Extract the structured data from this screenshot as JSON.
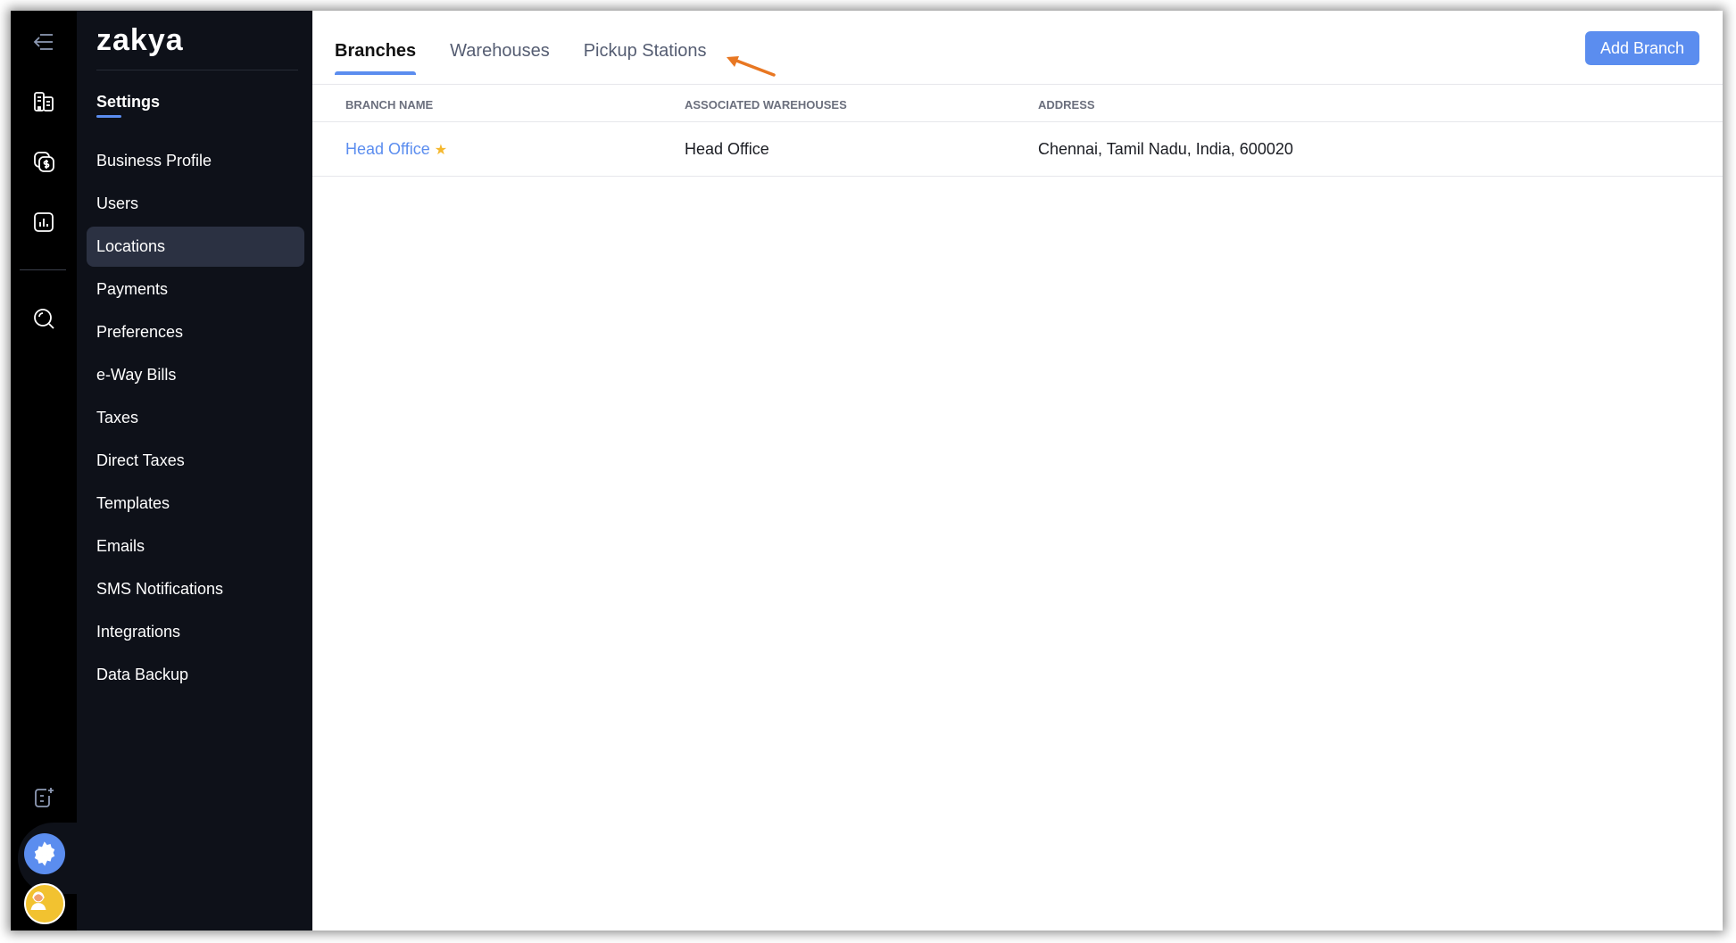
{
  "rail": {
    "icons": [
      "back-menu-icon",
      "branches-icon",
      "sales-icon",
      "reports-icon",
      "search-icon",
      "new-entry-icon",
      "settings-gear-icon",
      "user-avatar"
    ]
  },
  "sidebar": {
    "logo": "zakya",
    "title": "Settings",
    "items": [
      {
        "label": "Business Profile"
      },
      {
        "label": "Users"
      },
      {
        "label": "Locations",
        "active": true
      },
      {
        "label": "Payments"
      },
      {
        "label": "Preferences"
      },
      {
        "label": "e-Way Bills"
      },
      {
        "label": "Taxes"
      },
      {
        "label": "Direct Taxes"
      },
      {
        "label": "Templates"
      },
      {
        "label": "Emails"
      },
      {
        "label": "SMS Notifications"
      },
      {
        "label": "Integrations"
      },
      {
        "label": "Data Backup"
      }
    ]
  },
  "main": {
    "tabs": [
      {
        "label": "Branches",
        "active": true
      },
      {
        "label": "Warehouses"
      },
      {
        "label": "Pickup Stations"
      }
    ],
    "add_button": "Add Branch",
    "table": {
      "columns": [
        "BRANCH NAME",
        "ASSOCIATED WAREHOUSES",
        "ADDRESS"
      ],
      "rows": [
        {
          "branch": "Head Office",
          "primary": true,
          "warehouses": "Head Office",
          "address": "Chennai, Tamil Nadu, India, 600020"
        }
      ]
    }
  },
  "colors": {
    "accent": "#5b8def",
    "sidebar": "#0e1119",
    "annotation_arrow": "#e87722",
    "star": "#f5b82e"
  }
}
